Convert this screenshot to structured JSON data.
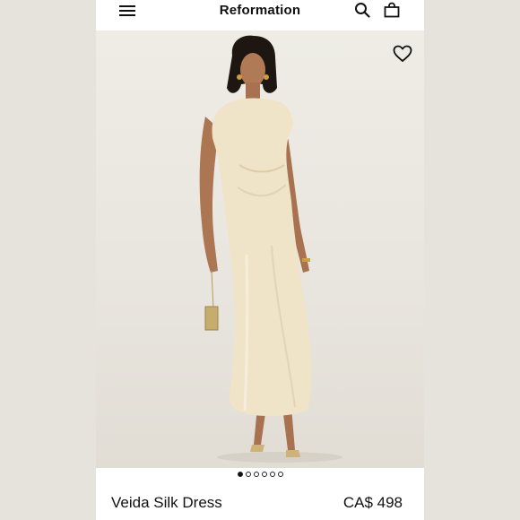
{
  "header": {
    "brand": "Reformation",
    "icons": [
      "menu-icon",
      "search-icon",
      "bag-icon"
    ]
  },
  "gallery": {
    "image_description_icon": "model-photo",
    "favorite_icon": "heart-icon",
    "dots": [
      {
        "active": true
      },
      {
        "active": false
      },
      {
        "active": false
      },
      {
        "active": false
      },
      {
        "active": false
      },
      {
        "active": false
      }
    ]
  },
  "product": {
    "name": "Veida Silk Dress",
    "price": "CA$ 498"
  },
  "colors": {
    "background": "#e6e3dc",
    "dress": "#efe3c8",
    "text": "#111111"
  }
}
